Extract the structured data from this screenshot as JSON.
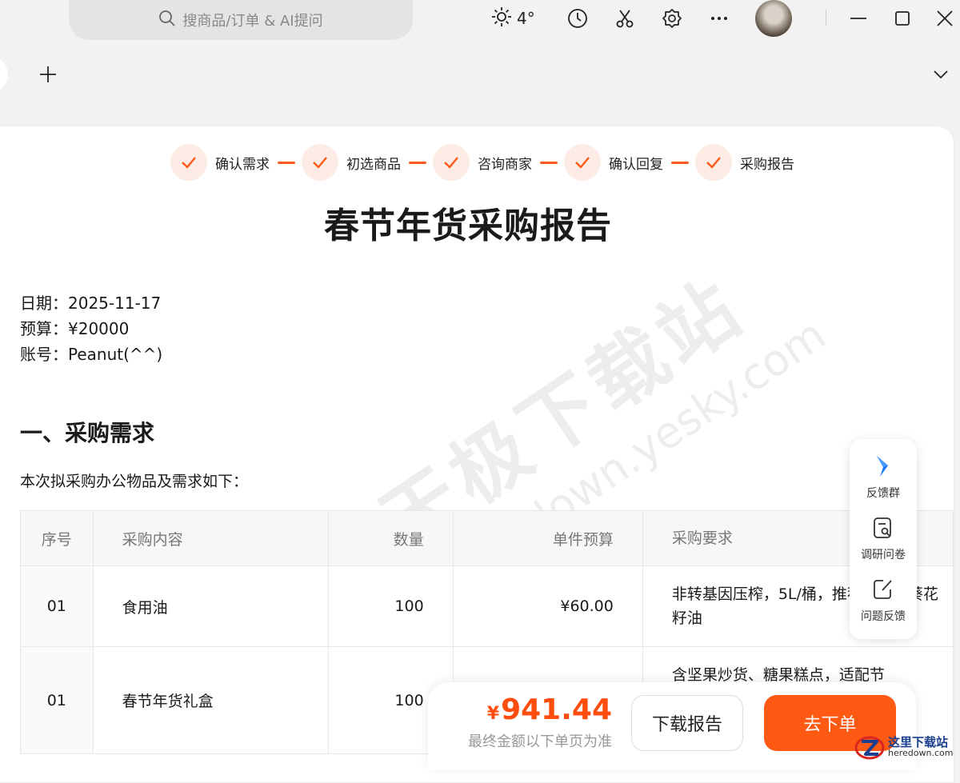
{
  "titlebar": {
    "search_placeholder": "搜商品/订单 & AI提问",
    "weather_temp": "4°"
  },
  "steps": [
    {
      "label": "确认需求"
    },
    {
      "label": "初选商品"
    },
    {
      "label": "咨询商家"
    },
    {
      "label": "确认回复"
    },
    {
      "label": "采购报告"
    }
  ],
  "document": {
    "title": "春节年货采购报告",
    "meta": [
      "日期：2025-11-17",
      "预算：¥20000",
      "账号：Peanut(^^)"
    ],
    "section_title": "一、采购需求",
    "intro": "本次拟采购办公物品及需求如下："
  },
  "table": {
    "headers": [
      "序号",
      "采购内容",
      "数量",
      "单件预算",
      "采购要求"
    ],
    "rows": [
      {
        "no": "01",
        "item": "食用油",
        "qty": "100",
        "budget": "¥60.00",
        "req": "非转基因压榨，5L/桶，推荐金龙鱼葵花籽油"
      },
      {
        "no": "01",
        "item": "春节年货礼盒",
        "qty": "100",
        "budget": "",
        "req": "含坚果炒货、糖果糕点，适配节"
      }
    ]
  },
  "side_panel": [
    {
      "label": "反馈群",
      "icon": "feedback-group-icon"
    },
    {
      "label": "调研问卷",
      "icon": "survey-icon"
    },
    {
      "label": "问题反馈",
      "icon": "edit-feedback-icon"
    }
  ],
  "bottom_bar": {
    "currency": "¥",
    "price": "941.44",
    "note": "最终金额以下单页为准",
    "download_label": "下载报告",
    "order_label": "去下单"
  },
  "watermark": {
    "line1": "天极下载站",
    "line2": "mydown.yesky.com"
  },
  "site_logo": {
    "cn": "这里下载站",
    "en": "heredown.com"
  },
  "colors": {
    "accent": "#ff5a14",
    "price": "#ff4d0d",
    "step_bg": "#fdece6"
  }
}
